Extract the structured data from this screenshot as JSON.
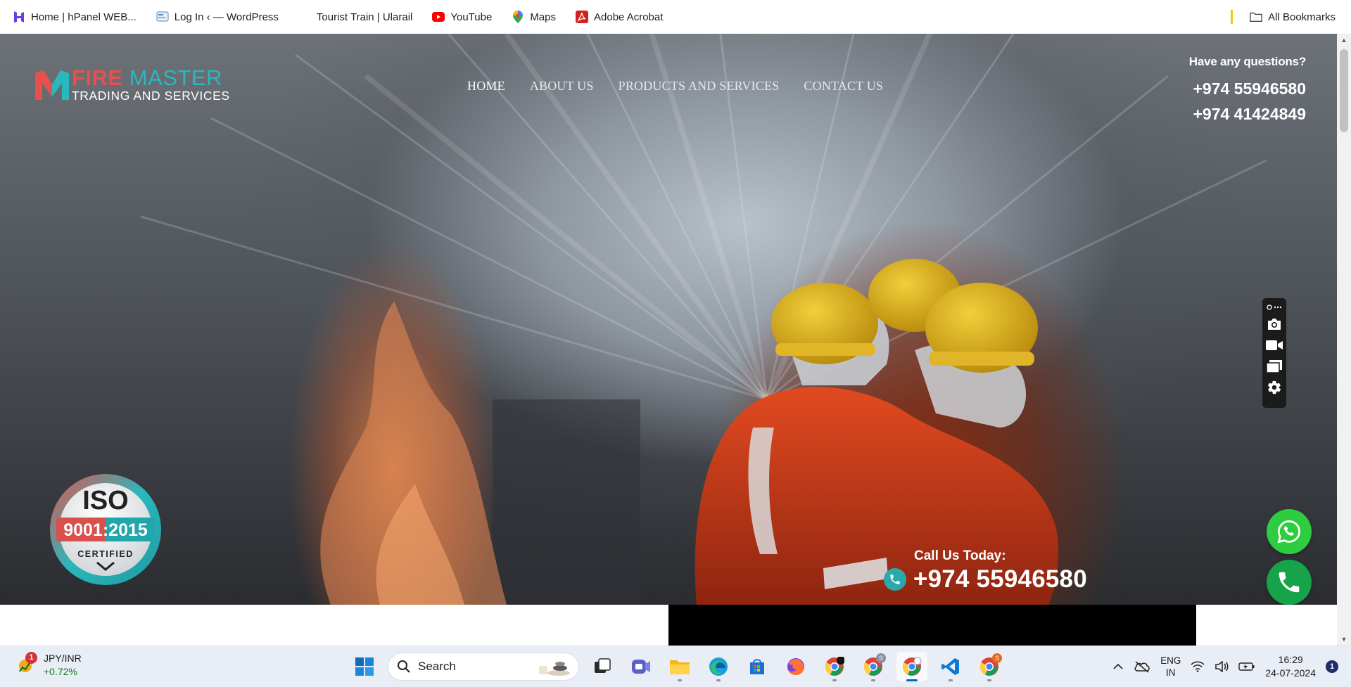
{
  "bookmarks": {
    "items": [
      {
        "label": "Home | hPanel WEB...",
        "icon": "hostinger-icon"
      },
      {
        "label": "Log In ‹ — WordPress",
        "icon": "wordpress-icon"
      },
      {
        "label": "Tourist Train | Ularail",
        "icon": "blank-page-icon"
      },
      {
        "label": "YouTube",
        "icon": "youtube-icon"
      },
      {
        "label": "Maps",
        "icon": "maps-icon"
      },
      {
        "label": "Adobe Acrobat",
        "icon": "acrobat-icon"
      }
    ],
    "all_bookmarks": "All Bookmarks"
  },
  "site": {
    "logo": {
      "fire": "FIRE",
      "master": "MASTER",
      "tagline": "TRADING AND SERVICES"
    },
    "nav": [
      "HOME",
      "ABOUT US",
      "PRODUCTS AND SERVICES",
      "CONTACT US"
    ],
    "nav_active": "HOME",
    "contact": {
      "question": "Have any questions?",
      "phone1": "+974 55946580",
      "phone2": "+974 41424849"
    },
    "iso": {
      "title": "ISO",
      "standard": "9001:2015",
      "certified": "CERTIFIED"
    },
    "call_us": {
      "label": "Call Us Today:",
      "phone": "+974 55946580"
    },
    "colors": {
      "brand_red": "#e8504b",
      "brand_teal": "#29b8bd",
      "whatsapp": "#2ecc40",
      "call": "#16a34a"
    }
  },
  "screenshot_toolbar": [
    "screenshot-camera-icon",
    "video-record-icon",
    "window-capture-icon",
    "settings-gear-icon"
  ],
  "taskbar": {
    "ticker": {
      "pair": "JPY/INR",
      "change": "+0.72%",
      "badge": "1"
    },
    "search_placeholder": "Search",
    "apps": [
      {
        "name": "start-windows-icon"
      },
      {
        "name": "task-view-icon"
      },
      {
        "name": "teams-meet-icon"
      },
      {
        "name": "file-explorer-icon"
      },
      {
        "name": "edge-browser-icon"
      },
      {
        "name": "microsoft-store-icon"
      },
      {
        "name": "firefox-icon"
      },
      {
        "name": "chrome-icon"
      },
      {
        "name": "chrome-profile-icon",
        "badge": "S"
      },
      {
        "name": "chrome-active-icon"
      },
      {
        "name": "vscode-icon"
      },
      {
        "name": "chrome-profile-2-icon",
        "badge": "S"
      }
    ],
    "tray": {
      "lang_line1": "ENG",
      "lang_line2": "IN",
      "time": "16:29",
      "date": "24-07-2024",
      "notifications": "1"
    }
  }
}
